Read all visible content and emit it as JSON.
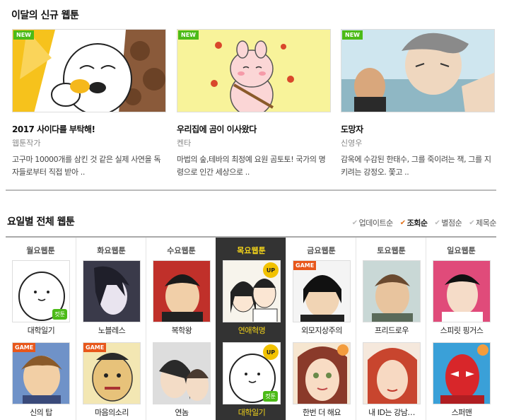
{
  "new_section": {
    "title": "이달의 신규 웹툰",
    "items": [
      {
        "badge": "NEW",
        "name": "2017 사이다를 부탁해!",
        "author": "웹툰작가",
        "desc": "고구마 10000개를 삼킨 것 같은 실제 사연을 독자들로부터 직접 받아 .."
      },
      {
        "badge": "NEW",
        "name": "우리집에 곰이 이사왔다",
        "author": "켄타",
        "desc": "마법의 숲,테바의 최정예 요원 곰토토! 국가의 명령으로 인간 세상으로 .."
      },
      {
        "badge": "NEW",
        "name": "도망자",
        "author": "신영우",
        "desc": "감옥에 수감된 한태수, 그를 죽이려는 잭, 그를 지키려는 강정오. 쫓고 .."
      }
    ]
  },
  "daily_section": {
    "title": "요일별 전체 웹툰",
    "sort": [
      {
        "label": "업데이트순",
        "active": false
      },
      {
        "label": "조회순",
        "active": true
      },
      {
        "label": "별점순",
        "active": false
      },
      {
        "label": "제목순",
        "active": false
      }
    ],
    "days": [
      {
        "label": "월요웹툰",
        "selected": false,
        "webtoons": [
          {
            "name": "대학일기",
            "badges": [
              "cut"
            ]
          },
          {
            "name": "신의 탑",
            "badges": [
              "game"
            ]
          }
        ]
      },
      {
        "label": "화요웹툰",
        "selected": false,
        "webtoons": [
          {
            "name": "노블레스",
            "badges": []
          },
          {
            "name": "마음의소리",
            "badges": [
              "game"
            ]
          }
        ]
      },
      {
        "label": "수요웹툰",
        "selected": false,
        "webtoons": [
          {
            "name": "복학왕",
            "badges": []
          },
          {
            "name": "연놈",
            "badges": []
          }
        ]
      },
      {
        "label": "목요웹툰",
        "selected": true,
        "webtoons": [
          {
            "name": "연애혁명",
            "badges": [
              "up"
            ]
          },
          {
            "name": "대학일기",
            "badges": [
              "up",
              "cut"
            ]
          }
        ]
      },
      {
        "label": "금요웹툰",
        "selected": false,
        "webtoons": [
          {
            "name": "외모지상주의",
            "badges": [
              "game"
            ]
          },
          {
            "name": "한번 더 해요",
            "badges": [
              "person"
            ]
          }
        ]
      },
      {
        "label": "토요웹툰",
        "selected": false,
        "webtoons": [
          {
            "name": "프리드로우",
            "badges": []
          },
          {
            "name": "내 ID는 강남…",
            "badges": []
          }
        ]
      },
      {
        "label": "일요웹툰",
        "selected": false,
        "webtoons": [
          {
            "name": "스피릿 핑거스",
            "badges": []
          },
          {
            "name": "스퍼맨",
            "badges": [
              "person"
            ]
          }
        ]
      }
    ],
    "badge_text": {
      "game": "GAME",
      "up": "UP",
      "cut": "컷툰"
    }
  }
}
